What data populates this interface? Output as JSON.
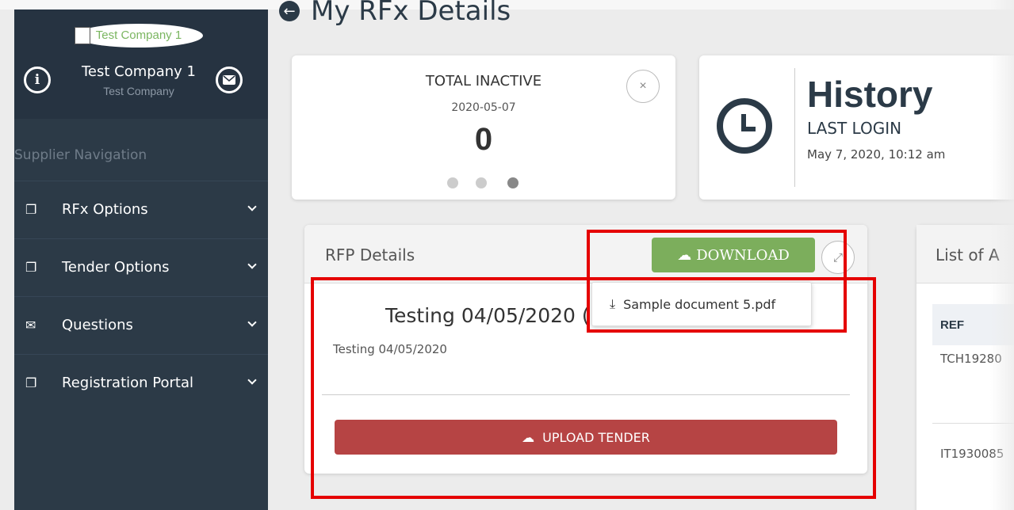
{
  "sidebar": {
    "logo_text": "Test Company 1",
    "company_name": "Test Company 1",
    "company_sub": "Test Company",
    "section_title": "Supplier Navigation",
    "items": [
      {
        "label": "RFx Options",
        "icon": "copy-icon"
      },
      {
        "label": "Tender Options",
        "icon": "copy-icon"
      },
      {
        "label": "Questions",
        "icon": "envelope-icon"
      },
      {
        "label": "Registration Portal",
        "icon": "copy-icon"
      }
    ]
  },
  "header": {
    "title": "My RFx Details"
  },
  "inactive_card": {
    "title": "TOTAL INACTIVE",
    "date": "2020-05-07",
    "value": "0",
    "close_symbol": "×"
  },
  "history_card": {
    "title": "History",
    "label": "LAST LOGIN",
    "date": "May 7, 2020, 10:12 am"
  },
  "rfp_card": {
    "title": "RFP Details",
    "download_label": "DOWNLOAD",
    "name": "Testing 04/05/2020 (",
    "description": "Testing 04/05/2020",
    "upload_label": "UPLOAD TENDER",
    "dropdown_item": "Sample document 5.pdf"
  },
  "list_card": {
    "title": "List of A",
    "column_ref": "REF",
    "rows": [
      "TCH19280",
      "IT1930085"
    ]
  },
  "colors": {
    "sidebar": "#2c3a47",
    "download_green": "#7cae5c",
    "upload_red": "#b64444",
    "highlight_red": "#e50000"
  }
}
